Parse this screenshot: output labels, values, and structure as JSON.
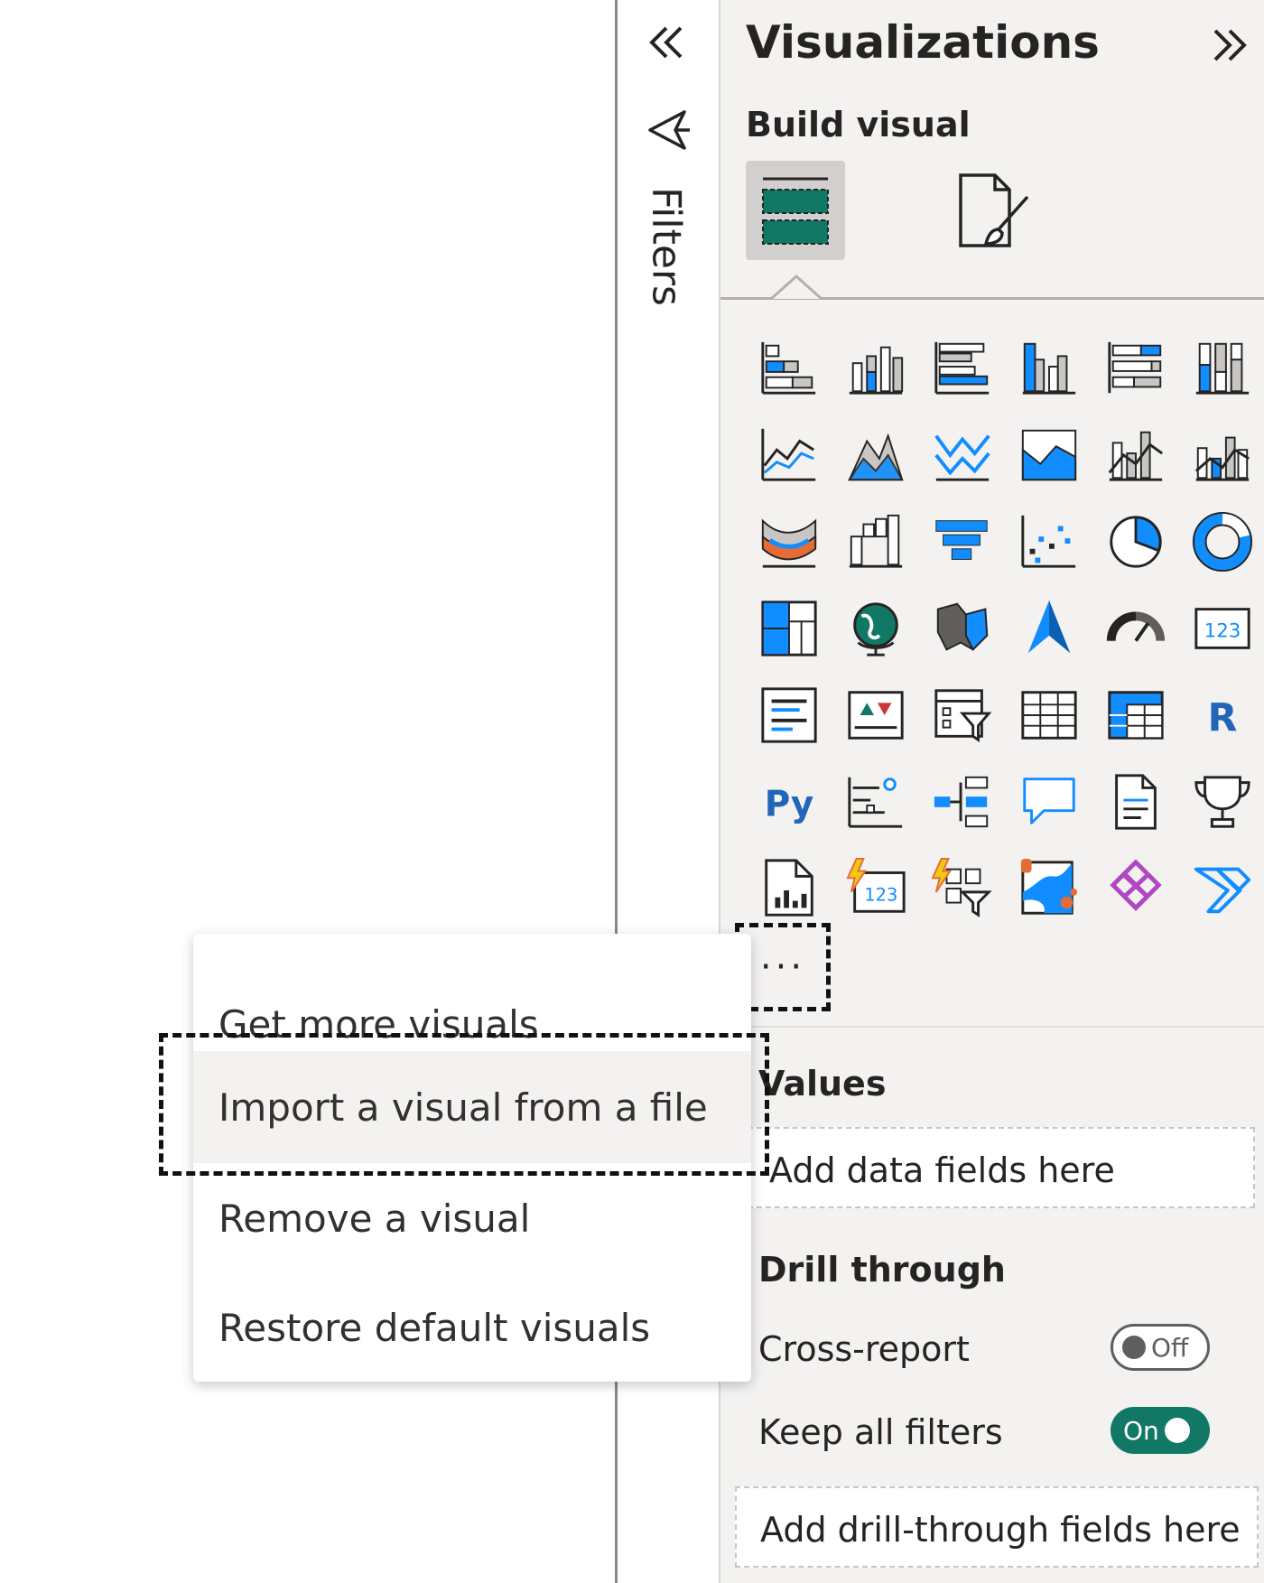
{
  "filters": {
    "label": "Filters"
  },
  "visualizations": {
    "title": "Visualizations",
    "build_visual_label": "Build visual",
    "more_label": "···",
    "icons": [
      "stacked-bar-chart-icon",
      "stacked-column-chart-icon",
      "clustered-bar-chart-icon",
      "clustered-column-chart-icon",
      "100-percent-stacked-bar-chart-icon",
      "100-percent-stacked-column-chart-icon",
      "line-chart-icon",
      "area-chart-icon",
      "stacked-area-chart-icon",
      "100-percent-stacked-area-chart-icon",
      "line-and-stacked-column-chart-icon",
      "line-and-clustered-column-chart-icon",
      "ribbon-chart-icon",
      "waterfall-chart-icon",
      "funnel-chart-icon",
      "scatter-chart-icon",
      "pie-chart-icon",
      "donut-chart-icon",
      "treemap-icon",
      "map-icon",
      "filled-map-icon",
      "azure-map-icon",
      "gauge-icon",
      "card-icon",
      "multi-row-card-icon",
      "kpi-icon",
      "slicer-icon",
      "table-icon",
      "matrix-icon",
      "r-script-visual-icon",
      "python-visual-icon",
      "key-influencers-icon",
      "decomposition-tree-icon",
      "qa-icon",
      "narrative-icon",
      "metrics-icon",
      "paginated-report-icon",
      "power-apps-card-icon",
      "power-apps-slicer-icon",
      "arcgis-map-icon",
      "power-apps-icon",
      "power-automate-icon"
    ]
  },
  "wells": {
    "values_label": "Values",
    "values_placeholder": "Add data fields here",
    "drill_through_label": "Drill through",
    "cross_report_label": "Cross-report",
    "cross_report_toggle": "Off",
    "keep_filters_label": "Keep all filters",
    "keep_filters_toggle": "On",
    "drill_placeholder": "Add drill-through fields here"
  },
  "context_menu": {
    "items": [
      "Get more visuals",
      "Import a visual from a file",
      "Remove a visual",
      "Restore default visuals"
    ],
    "highlighted_index": 1
  },
  "colors": {
    "accent_teal": "#117865",
    "accent_blue": "#118dff",
    "pane_bg": "#f3f2f1",
    "icon_gray": "#605e5c"
  }
}
